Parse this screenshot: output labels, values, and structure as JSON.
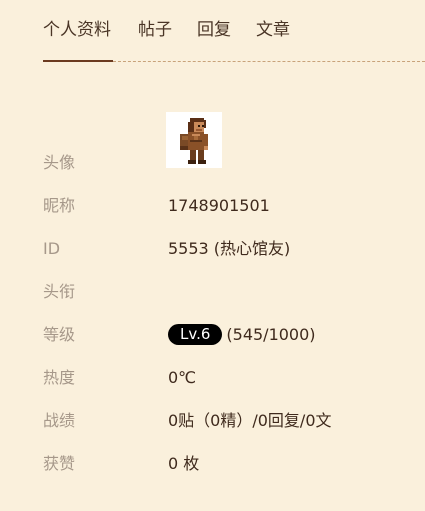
{
  "tabs": [
    {
      "label": "个人资料",
      "active": true
    },
    {
      "label": "帖子",
      "active": false
    },
    {
      "label": "回复",
      "active": false
    },
    {
      "label": "文章",
      "active": false
    }
  ],
  "profile": {
    "avatar_label": "头像",
    "avatar_icon": "pixel-character-avatar",
    "nickname_label": "昵称",
    "nickname_value": "1748901501",
    "id_label": "ID",
    "id_value": "5553 (热心馆友)",
    "title_label": "头衔",
    "title_value": "",
    "level_label": "等级",
    "level_badge": "Lv.6",
    "level_progress": "(545/1000)",
    "heat_label": "热度",
    "heat_value": "0℃",
    "record_label": "战绩",
    "record_value": "0贴（0精）/0回复/0文",
    "likes_label": "获赞",
    "likes_value": "0 枚"
  },
  "colors": {
    "background": "#faf0dc",
    "tab_accent": "#6b3a1f",
    "label_text": "#a6988a",
    "value_text": "#3f2a1d",
    "badge_bg": "#000000"
  }
}
